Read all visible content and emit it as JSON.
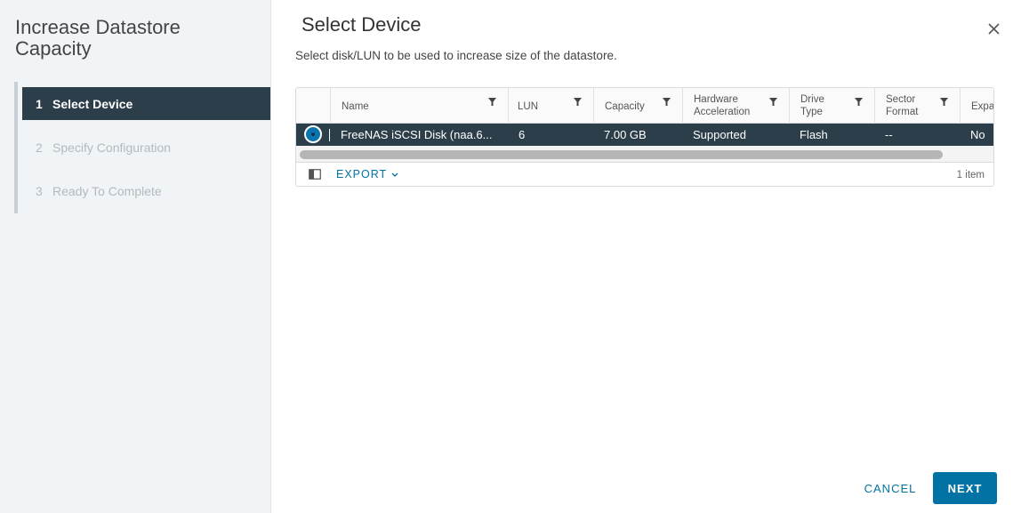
{
  "wizard": {
    "title": "Increase Datastore Capacity",
    "steps": [
      {
        "num": "1",
        "label": "Select Device"
      },
      {
        "num": "2",
        "label": "Specify Configuration"
      },
      {
        "num": "3",
        "label": "Ready To Complete"
      }
    ]
  },
  "main": {
    "title": "Select Device",
    "subtitle": "Select disk/LUN to be used to increase size of the datastore."
  },
  "grid": {
    "columns": [
      {
        "label": "Name"
      },
      {
        "label": "LUN"
      },
      {
        "label": "Capacity"
      },
      {
        "label": "Hardware Acceleration"
      },
      {
        "label": "Drive Type"
      },
      {
        "label": "Sector Format"
      },
      {
        "label": "Expa"
      }
    ],
    "rows": [
      {
        "name": "FreeNAS iSCSI Disk (naa.6...",
        "lun": "6",
        "capacity": "7.00 GB",
        "hw_accel": "Supported",
        "drive_type": "Flash",
        "sector_format": "--",
        "expandable": "No",
        "selected": true
      }
    ],
    "footer": {
      "export_label": "EXPORT",
      "item_count": "1 item"
    }
  },
  "buttons": {
    "cancel": "CANCEL",
    "next": "NEXT"
  },
  "colors": {
    "accent": "#0072a3",
    "selected_row": "#2c3e4a",
    "sidebar_bg": "#f1f4f6"
  },
  "icons": [
    "close-icon",
    "filter-icon",
    "column-toggle-icon",
    "chevron-down-icon"
  ]
}
